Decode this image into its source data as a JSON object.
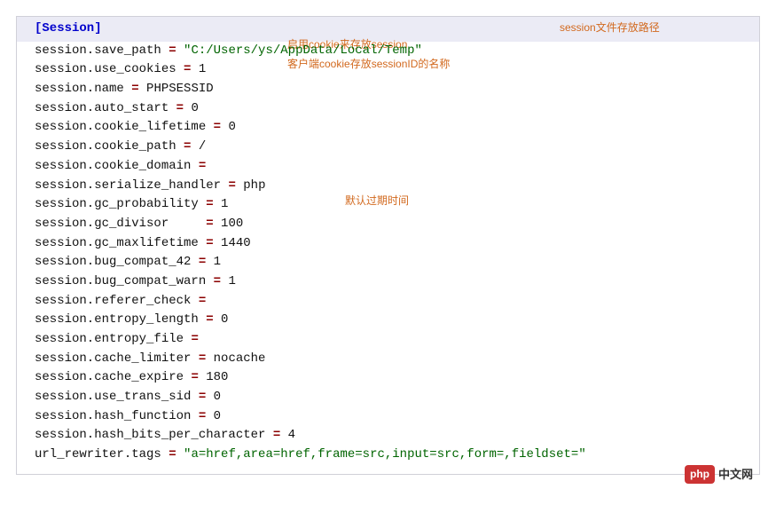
{
  "section_header": "[Session]",
  "comments": {
    "save_path": "session文件存放路径",
    "use_cookies": "启用cookie来存放session",
    "name": "客户端cookie存放sessionID的名称",
    "gc_maxlifetime": "默认过期时间"
  },
  "lines": [
    {
      "key": "session.save_path",
      "pad": "",
      "val": " \"C:/Users/ys/AppData/Local/Temp\"",
      "valClass": "str"
    },
    {
      "key": "session.use_cookies",
      "pad": "",
      "val": " 1"
    },
    {
      "key": "session.name",
      "pad": "",
      "val": " PHPSESSID"
    },
    {
      "key": "session.auto_start",
      "pad": "",
      "val": " 0"
    },
    {
      "key": "session.cookie_lifetime",
      "pad": "",
      "val": " 0"
    },
    {
      "key": "session.cookie_path",
      "pad": "",
      "val": " /"
    },
    {
      "key": "session.cookie_domain",
      "pad": "",
      "val": ""
    },
    {
      "key": "session.serialize_handler",
      "pad": "",
      "val": " php"
    },
    {
      "key": "session.gc_probability",
      "pad": "",
      "val": " 1"
    },
    {
      "key": "session.gc_divisor    ",
      "pad": "",
      "val": " 100"
    },
    {
      "key": "session.gc_maxlifetime",
      "pad": "",
      "val": " 1440"
    },
    {
      "key": "session.bug_compat_42",
      "pad": "",
      "val": " 1"
    },
    {
      "key": "session.bug_compat_warn",
      "pad": "",
      "val": " 1"
    },
    {
      "key": "session.referer_check",
      "pad": "",
      "val": ""
    },
    {
      "key": "session.entropy_length",
      "pad": "",
      "val": " 0"
    },
    {
      "key": "session.entropy_file",
      "pad": "",
      "val": ""
    },
    {
      "key": "session.cache_limiter",
      "pad": "",
      "val": " nocache"
    },
    {
      "key": "session.cache_expire",
      "pad": "",
      "val": " 180"
    },
    {
      "key": "session.use_trans_sid",
      "pad": "",
      "val": " 0"
    },
    {
      "key": "session.hash_function",
      "pad": "",
      "val": " 0"
    },
    {
      "key": "session.hash_bits_per_character",
      "pad": "",
      "val": " 4"
    },
    {
      "key": "url_rewriter.tags",
      "pad": "",
      "val": " \"a=href,area=href,frame=src,input=src,form=,fieldset=\"",
      "valClass": "str"
    }
  ],
  "watermark": {
    "badge": "php",
    "text": "中文网"
  }
}
